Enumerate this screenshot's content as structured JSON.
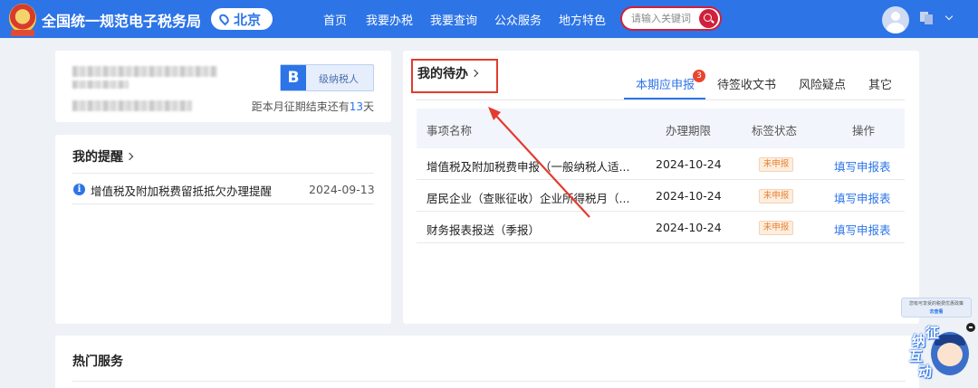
{
  "header": {
    "title": "全国统一规范电子税务局",
    "city": "北京",
    "nav": [
      "首页",
      "我要办税",
      "我要查询",
      "公众服务",
      "地方特色"
    ],
    "search_placeholder": "请输入关键词"
  },
  "taxpayer": {
    "grade": "B",
    "grade_label": "级纳税人",
    "deadline_prefix": "距本月征期结束还有",
    "deadline_days": "13",
    "deadline_suffix": "天"
  },
  "reminders": {
    "title": "我的提醒",
    "items": [
      {
        "text": "增值税及附加税费留抵抵欠办理提醒",
        "date": "2024-09-13"
      }
    ]
  },
  "todo": {
    "title": "我的待办",
    "tabs": [
      {
        "label": "本期应申报",
        "badge": "3",
        "active": true
      },
      {
        "label": "待签收文书"
      },
      {
        "label": "风险疑点"
      },
      {
        "label": "其它"
      }
    ],
    "columns": [
      "事项名称",
      "办理期限",
      "标签状态",
      "操作"
    ],
    "rows": [
      {
        "name": "增值税及附加税费申报（一般纳税人适...",
        "deadline": "2024-10-24",
        "status": "未申报",
        "action": "填写申报表"
      },
      {
        "name": "居民企业（查账征收）企业所得税月（...",
        "deadline": "2024-10-24",
        "status": "未申报",
        "action": "填写申报表"
      },
      {
        "name": "财务报表报送（季报）",
        "deadline": "2024-10-24",
        "status": "未申报",
        "action": "填写申报表"
      }
    ]
  },
  "hot_services": {
    "title": "热门服务"
  },
  "assistant": {
    "tip_line1": "您有可享受的税费优惠政策",
    "tip_line2": "去查看",
    "chars": [
      "征",
      "纳",
      "互",
      "动"
    ]
  },
  "colors": {
    "brand": "#2d74e7",
    "alert": "#e33b2e",
    "pending": "#e8822f"
  }
}
